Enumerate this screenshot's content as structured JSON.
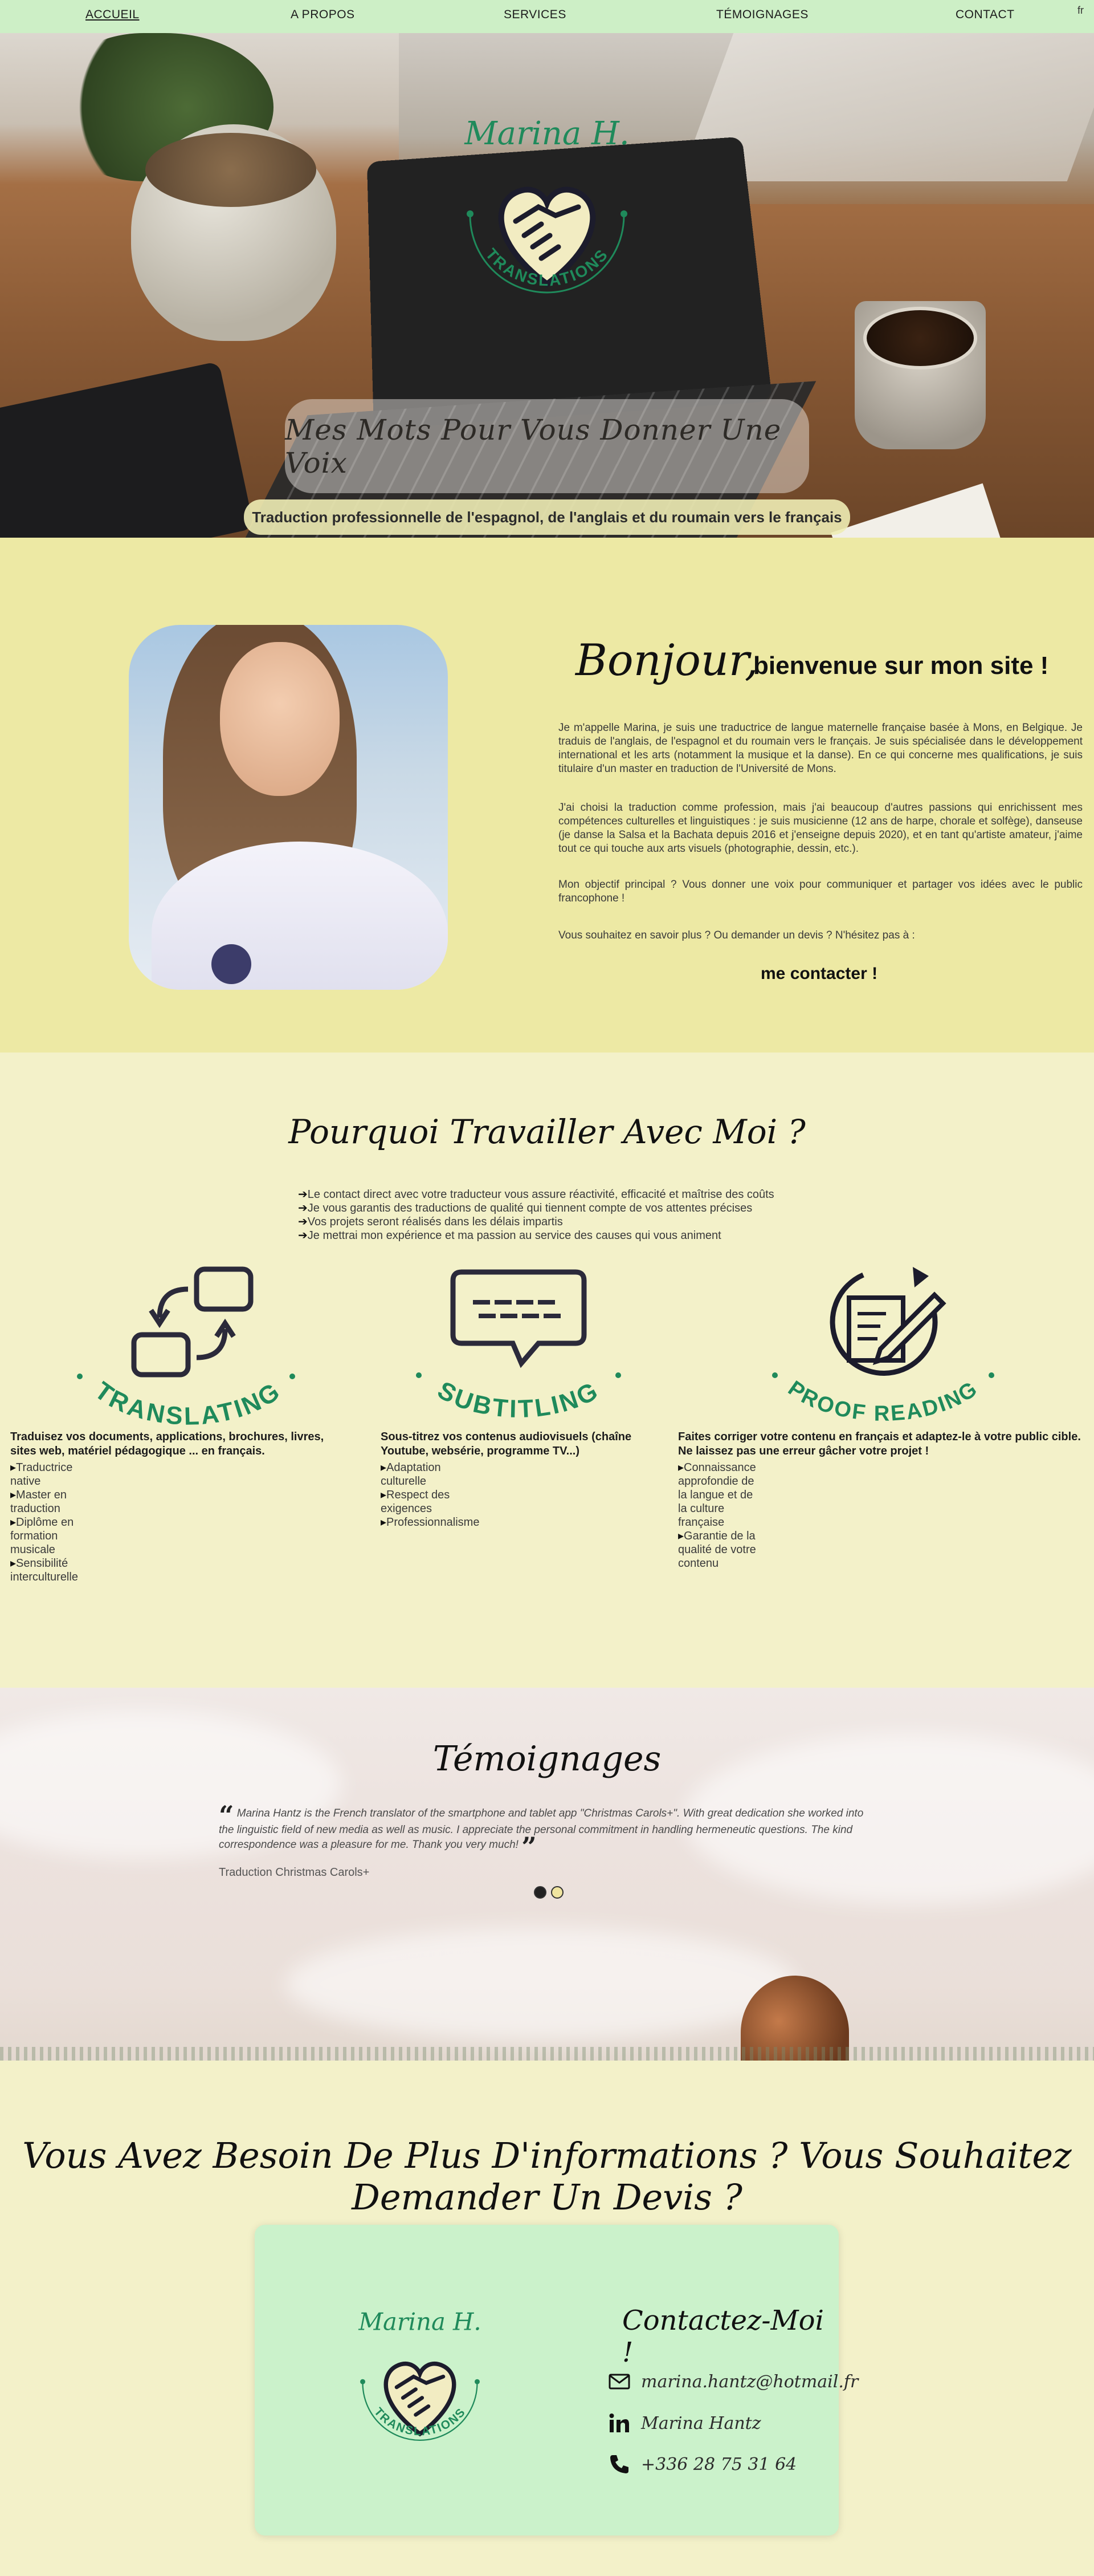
{
  "nav": {
    "items": [
      "ACCUEIL",
      "A PROPOS",
      "SERVICES",
      "TÉMOIGNAGES",
      "CONTACT"
    ],
    "lang": "fr"
  },
  "hero": {
    "brand_name": "Marina H.",
    "brand_sub": "TRANSLATIONS",
    "tagline": "Mes Mots Pour Vous Donner Une Voix",
    "subtitle": "Traduction professionnelle de l'espagnol, de l'anglais et du roumain vers le français"
  },
  "about": {
    "bonjour": "Bonjour,",
    "welcome": "bienvenue sur mon site !",
    "p1": "Je m'appelle Marina, je suis une traductrice de langue maternelle française basée à Mons, en Belgique. Je traduis de l'anglais, de l'espagnol et du roumain vers le français. Je suis spécialisée dans le développement international et les arts (notamment la musique et la danse). En ce qui concerne mes qualifications, je suis titulaire d'un master en traduction de l'Université de Mons.",
    "p2": "J'ai choisi la traduction comme profession, mais j'ai beaucoup d'autres passions qui enrichissent mes compétences culturelles et linguistiques : je suis musicienne (12 ans de harpe, chorale et solfège), danseuse (je danse la Salsa et la Bachata depuis 2016 et j'enseigne depuis 2020), et en tant qu'artiste amateur, j'aime tout ce qui touche aux arts visuels (photographie, dessin, etc.).",
    "p3": "Mon objectif principal ? Vous donner une voix pour communiquer et partager vos idées avec le public francophone !",
    "p4": "Vous souhaitez en savoir plus ? Ou demander un devis ? N'hésitez pas à :",
    "contact_link": "me contacter !"
  },
  "services": {
    "title": "Pourquoi Travailler Avec Moi ?",
    "why": [
      "Le contact direct avec votre traducteur vous assure réactivité, efficacité et maîtrise des coûts",
      "Je vous garantis des traductions de qualité qui tiennent compte de vos attentes précises",
      "Vos projets seront réalisés dans les délais impartis",
      "Je mettrai mon expérience et ma passion au service des causes qui vous animent"
    ],
    "items": [
      {
        "label": "TRANSLATING",
        "desc": "Traduisez vos documents, applications, brochures, livres, sites web, matériel pédagogique ... en français.",
        "bullets": [
          "Traductrice native",
          "Master en traduction",
          "Diplôme en formation musicale",
          "Sensibilité interculturelle"
        ]
      },
      {
        "label": "SUBTITLING",
        "desc": "Sous-titrez vos contenus audiovisuels (chaîne Youtube, websérie, programme TV...)",
        "bullets": [
          "Adaptation culturelle",
          "Respect des exigences",
          "Professionnalisme"
        ]
      },
      {
        "label": "PROOF READING",
        "desc": "Faites corriger votre contenu en français et adaptez-le à votre public cible. Ne laissez pas une erreur gâcher votre projet !",
        "bullets": [
          "Connaissance approfondie de la langue et de la culture française",
          "Garantie de la qualité de votre contenu"
        ]
      }
    ]
  },
  "testimonials": {
    "title": "Témoignages",
    "quote": "Marina Hantz is the French translator of the smartphone and tablet app \"Christmas Carols+\". With great dedication she worked into the linguistic field of new media as well as music. I appreciate the personal commitment in handling hermeneutic questions. The kind correspondence was a pleasure for me. Thank you very much!",
    "source": "Traduction Christmas Carols+"
  },
  "contact": {
    "heading": "Vous Avez Besoin De Plus D'informations ? Vous Souhaitez Demander Un Devis ?",
    "card_title": "Contactez-Moi !",
    "email": "marina.hantz@hotmail.fr",
    "linkedin": "Marina Hantz",
    "phone": "+336 28 75 31 64"
  },
  "colors": {
    "nav_bg": "#cdefc6",
    "about_bg": "#ede9a4",
    "page_bg": "#f3f1c9",
    "accent_green": "#1f8a5b",
    "logo_fill": "#f2ecc2",
    "card_bg": "#cbf2cb"
  },
  "icons": [
    "handshake-heart-icon",
    "cycle-arrows-icon",
    "speech-bubble-icon",
    "notepad-pen-icon",
    "envelope-icon",
    "linkedin-icon",
    "phone-icon",
    "quote-open-icon",
    "quote-close-icon"
  ]
}
